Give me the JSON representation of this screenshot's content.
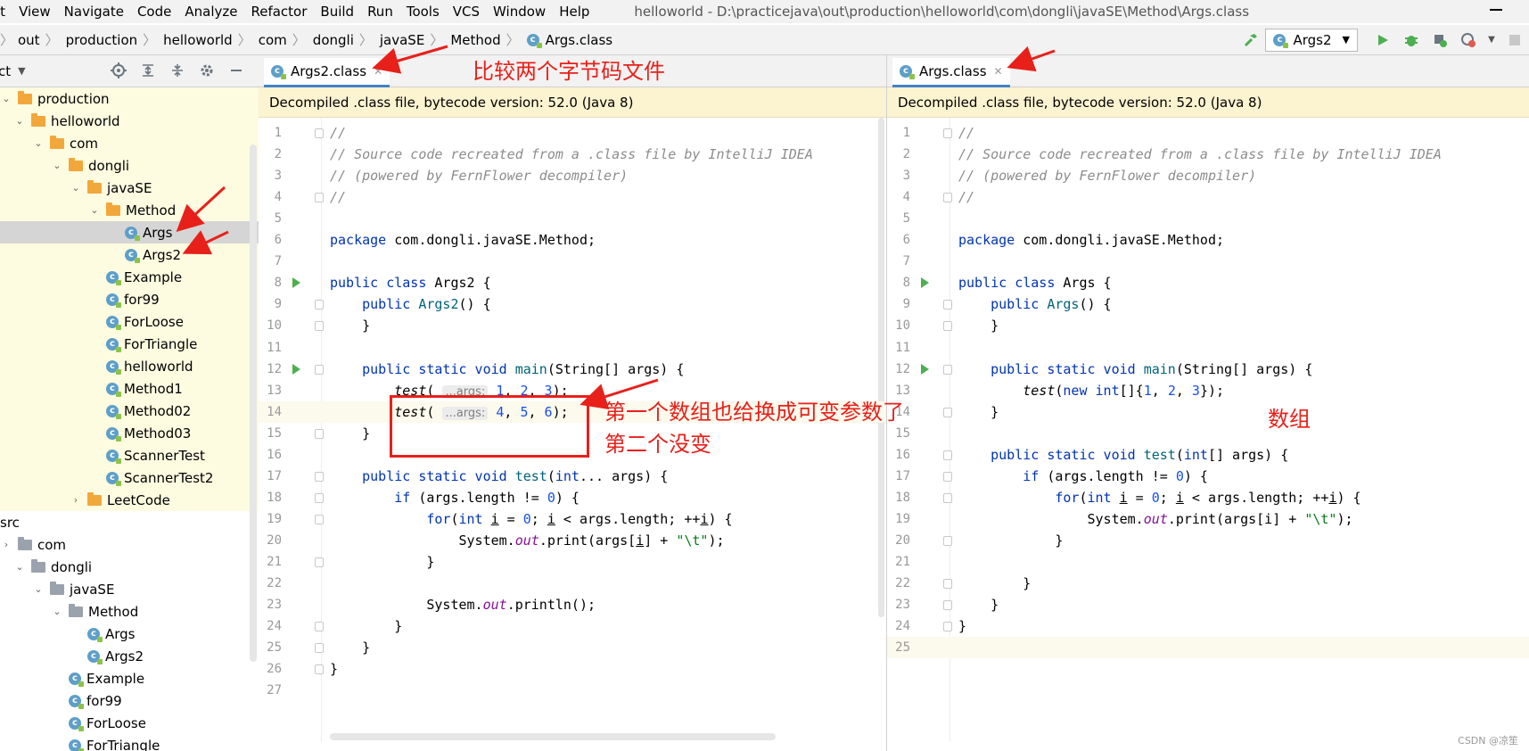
{
  "menubar": {
    "items": [
      "it",
      "View",
      "Navigate",
      "Code",
      "Analyze",
      "Refactor",
      "Build",
      "Run",
      "Tools",
      "VCS",
      "Window",
      "Help"
    ],
    "window_title": "helloworld - D:\\practicejava\\out\\production\\helloworld\\com\\dongli\\javaSE\\Method\\Args.class"
  },
  "navbar": {
    "breadcrumbs": [
      "out",
      "production",
      "helloworld",
      "com",
      "dongli",
      "javaSE",
      "Method"
    ],
    "file": "Args.class",
    "run_config": "Args2"
  },
  "project": {
    "header_label": "ct",
    "tree": [
      {
        "label": "production",
        "indent": 0,
        "type": "folder",
        "expanded": true,
        "hl": true
      },
      {
        "label": "helloworld",
        "indent": 1,
        "type": "folder",
        "expanded": true,
        "hl": true
      },
      {
        "label": "com",
        "indent": 2,
        "type": "folder",
        "expanded": true,
        "hl": true
      },
      {
        "label": "dongli",
        "indent": 3,
        "type": "folder",
        "expanded": true,
        "hl": true
      },
      {
        "label": "javaSE",
        "indent": 4,
        "type": "folder",
        "expanded": true,
        "hl": true
      },
      {
        "label": "Method",
        "indent": 5,
        "type": "folder",
        "expanded": true,
        "hl": true
      },
      {
        "label": "Args",
        "indent": 6,
        "type": "class",
        "hl": true,
        "selected": true
      },
      {
        "label": "Args2",
        "indent": 6,
        "type": "class",
        "hl": true
      },
      {
        "label": "Example",
        "indent": 5,
        "type": "class",
        "hl": true
      },
      {
        "label": "for99",
        "indent": 5,
        "type": "class",
        "hl": true
      },
      {
        "label": "ForLoose",
        "indent": 5,
        "type": "class",
        "hl": true
      },
      {
        "label": "ForTriangle",
        "indent": 5,
        "type": "class",
        "hl": true
      },
      {
        "label": "helloworld",
        "indent": 5,
        "type": "class",
        "hl": true
      },
      {
        "label": "Method1",
        "indent": 5,
        "type": "class",
        "hl": true
      },
      {
        "label": "Method02",
        "indent": 5,
        "type": "class",
        "hl": true
      },
      {
        "label": "Method03",
        "indent": 5,
        "type": "class",
        "hl": true
      },
      {
        "label": "ScannerTest",
        "indent": 5,
        "type": "class",
        "hl": true
      },
      {
        "label": "ScannerTest2",
        "indent": 5,
        "type": "class",
        "hl": true
      },
      {
        "label": "LeetCode",
        "indent": 4,
        "type": "folder",
        "expanded": false,
        "hl": true
      },
      {
        "label": "src",
        "indent": 0,
        "type": "text",
        "hl": false
      },
      {
        "label": "com",
        "indent": 0,
        "type": "pkg",
        "expanded": false,
        "hl": false
      },
      {
        "label": "dongli",
        "indent": 1,
        "type": "pkg",
        "expanded": true,
        "hl": false
      },
      {
        "label": "javaSE",
        "indent": 2,
        "type": "pkg",
        "expanded": true,
        "hl": false
      },
      {
        "label": "Method",
        "indent": 3,
        "type": "pkg",
        "expanded": true,
        "hl": false
      },
      {
        "label": "Args",
        "indent": 4,
        "type": "class",
        "hl": false
      },
      {
        "label": "Args2",
        "indent": 4,
        "type": "class",
        "hl": false
      },
      {
        "label": "Example",
        "indent": 3,
        "type": "class",
        "hl": false
      },
      {
        "label": "for99",
        "indent": 3,
        "type": "class",
        "hl": false
      },
      {
        "label": "ForLoose",
        "indent": 3,
        "type": "class",
        "hl": false
      },
      {
        "label": "ForTriangle",
        "indent": 3,
        "type": "class",
        "hl": false
      }
    ]
  },
  "editors": {
    "left": {
      "tab": "Args2.class",
      "banner": "Decompiled .class file, bytecode version: 52.0 (Java 8)",
      "lines": [
        {
          "n": "1",
          "fold": true,
          "t": "<span class=\"cm\">//</span>"
        },
        {
          "n": "2",
          "t": "<span class=\"cm\">// Source code recreated from a .class file by IntelliJ IDEA</span>"
        },
        {
          "n": "3",
          "t": "<span class=\"cm\">// (powered by FernFlower decompiler)</span>"
        },
        {
          "n": "4",
          "fold": true,
          "t": "<span class=\"cm\">//</span>"
        },
        {
          "n": "5",
          "t": ""
        },
        {
          "n": "6",
          "t": "<span class=\"kw\">package</span> com.dongli.javaSE.Method;"
        },
        {
          "n": "7",
          "t": ""
        },
        {
          "n": "8",
          "run": true,
          "t": "<span class=\"kw\">public class</span> Args2 {"
        },
        {
          "n": "9",
          "fold": true,
          "t": "    <span class=\"kw\">public</span> <span class=\"fn\">Args2</span>() {"
        },
        {
          "n": "10",
          "fold": true,
          "t": "    }"
        },
        {
          "n": "11",
          "t": ""
        },
        {
          "n": "12",
          "run": true,
          "fold": true,
          "t": "    <span class=\"kw\">public static void</span> <span class=\"fn\">main</span>(String[] args) {"
        },
        {
          "n": "13",
          "t": "        <span class=\"it\">test</span>( <span class=\"hint\">...args:</span> <span class=\"num\">1</span>, <span class=\"num\">2</span>, <span class=\"num\">3</span>);"
        },
        {
          "n": "14",
          "cur": true,
          "t": "        <span class=\"it\">test</span>( <span class=\"hint\">...args:</span> <span class=\"num\">4</span>, <span class=\"num\">5</span>, <span class=\"num\">6</span>);"
        },
        {
          "n": "15",
          "fold": true,
          "t": "    }"
        },
        {
          "n": "16",
          "t": ""
        },
        {
          "n": "17",
          "fold": true,
          "t": "    <span class=\"kw\">public static void</span> <span class=\"fn\">test</span>(<span class=\"kw\">int</span>... args) {"
        },
        {
          "n": "18",
          "fold": true,
          "t": "        <span class=\"kw\">if</span> (args.length != <span class=\"num\">0</span>) {"
        },
        {
          "n": "19",
          "fold": true,
          "t": "            <span class=\"kw\">for</span>(<span class=\"kw\">int</span> <span class=\"ul\">i</span> = <span class=\"num\">0</span>; <span class=\"ul\">i</span> &lt; args.length; ++<span class=\"ul\">i</span>) {"
        },
        {
          "n": "20",
          "t": "                System.<span class=\"fld\">out</span>.print(args[<span class=\"ul\">i</span>] + <span class=\"str\">\"\\t\"</span>);"
        },
        {
          "n": "21",
          "fold": true,
          "t": "            }"
        },
        {
          "n": "22",
          "t": ""
        },
        {
          "n": "23",
          "t": "            System.<span class=\"fld\">out</span>.println();"
        },
        {
          "n": "24",
          "fold": true,
          "t": "        }"
        },
        {
          "n": "25",
          "fold": true,
          "t": "    }"
        },
        {
          "n": "26",
          "fold": true,
          "t": "}"
        },
        {
          "n": "27",
          "t": ""
        }
      ]
    },
    "right": {
      "tab": "Args.class",
      "banner": "Decompiled .class file, bytecode version: 52.0 (Java 8)",
      "lines": [
        {
          "n": "1",
          "fold": true,
          "t": "<span class=\"cm\">//</span>"
        },
        {
          "n": "2",
          "t": "<span class=\"cm\">// Source code recreated from a .class file by IntelliJ IDEA</span>"
        },
        {
          "n": "3",
          "t": "<span class=\"cm\">// (powered by FernFlower decompiler)</span>"
        },
        {
          "n": "4",
          "fold": true,
          "t": "<span class=\"cm\">//</span>"
        },
        {
          "n": "5",
          "t": ""
        },
        {
          "n": "6",
          "t": "<span class=\"kw\">package</span> com.dongli.javaSE.Method;"
        },
        {
          "n": "7",
          "t": ""
        },
        {
          "n": "8",
          "run": true,
          "t": "<span class=\"kw\">public class</span> Args {"
        },
        {
          "n": "9",
          "fold": true,
          "t": "    <span class=\"kw\">public</span> <span class=\"fn\">Args</span>() {"
        },
        {
          "n": "10",
          "fold": true,
          "t": "    }"
        },
        {
          "n": "11",
          "t": ""
        },
        {
          "n": "12",
          "run": true,
          "fold": true,
          "t": "    <span class=\"kw\">public static void</span> <span class=\"fn\">main</span>(String[] args) {"
        },
        {
          "n": "13",
          "t": "        <span class=\"it\">test</span>(<span class=\"kw\">new int</span>[]{<span class=\"num\">1</span>, <span class=\"num\">2</span>, <span class=\"num\">3</span>});"
        },
        {
          "n": "14",
          "fold": true,
          "t": "    }"
        },
        {
          "n": "15",
          "t": ""
        },
        {
          "n": "16",
          "fold": true,
          "t": "    <span class=\"kw\">public static void</span> <span class=\"fn\">test</span>(<span class=\"kw\">int</span>[] args) {"
        },
        {
          "n": "17",
          "fold": true,
          "t": "        <span class=\"kw\">if</span> (args.length != <span class=\"num\">0</span>) {"
        },
        {
          "n": "18",
          "fold": true,
          "t": "            <span class=\"kw\">for</span>(<span class=\"kw\">int</span> <span class=\"ul\">i</span> = <span class=\"num\">0</span>; <span class=\"ul\">i</span> &lt; args.length; ++<span class=\"ul\">i</span>) {"
        },
        {
          "n": "19",
          "t": "                System.<span class=\"fld\">out</span>.print(args[i] + <span class=\"str\">\"\\t\"</span>);"
        },
        {
          "n": "20",
          "fold": true,
          "t": "            }"
        },
        {
          "n": "21",
          "t": ""
        },
        {
          "n": "22",
          "fold": true,
          "t": "        }"
        },
        {
          "n": "23",
          "fold": true,
          "t": "    }"
        },
        {
          "n": "24",
          "fold": true,
          "t": "}"
        },
        {
          "n": "25",
          "cur": true,
          "t": ""
        }
      ]
    }
  },
  "annotations": {
    "compare": "比较两个字节码文件",
    "changed": "第一个数组也给换成可变参数了",
    "unchanged": "第二个没变",
    "array": "数组"
  },
  "watermark": "CSDN @凉笙",
  "colors": {
    "accent": "#4083c9",
    "annotation": "#e8201a",
    "banner": "#fcf3d0",
    "tree_highlight": "#fdfbe0"
  }
}
